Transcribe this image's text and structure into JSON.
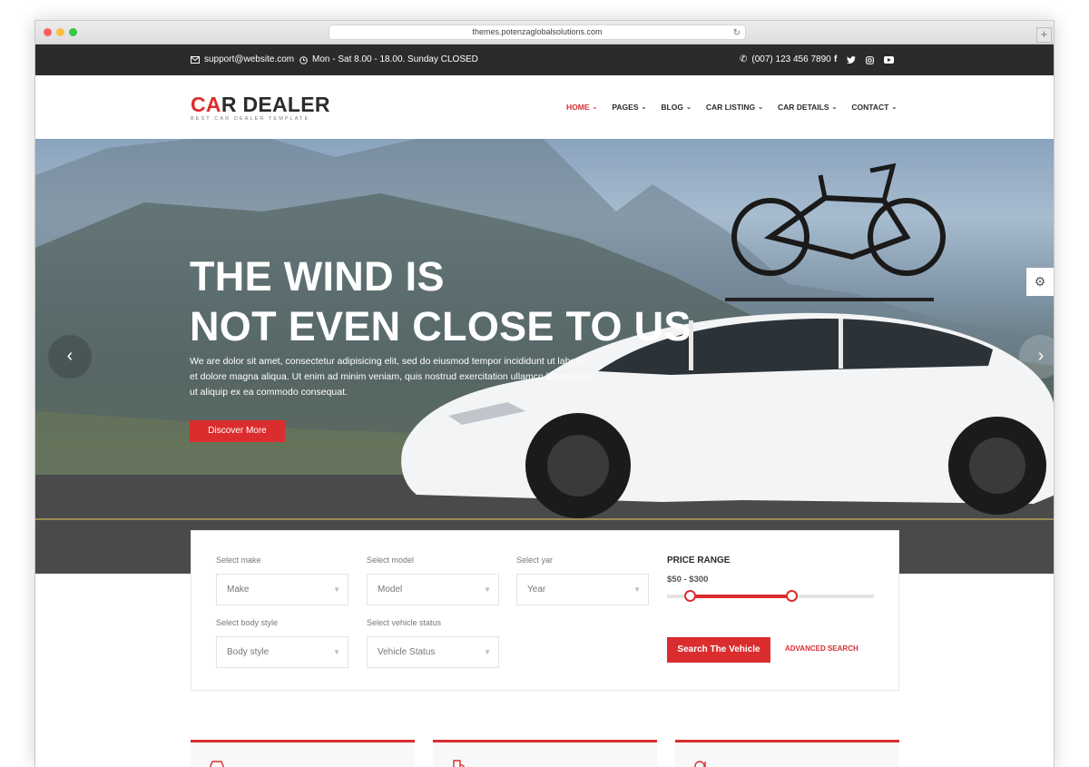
{
  "browser": {
    "url": "themes.potenzaglobalsolutions.com",
    "reload_icon": "↻",
    "newtab_icon": "+"
  },
  "topbar": {
    "email": "support@website.com",
    "hours": "Mon - Sat 8.00 - 18.00. Sunday CLOSED",
    "phone": "(007) 123 456 7890",
    "social_icons": [
      "facebook-icon",
      "twitter-icon",
      "instagram-icon",
      "youtube-icon"
    ]
  },
  "logo": {
    "prefix": "C",
    "red_part": "A",
    "rest": "R DEALER",
    "tagline": "BEST CAR DEALER TEMPLATE"
  },
  "nav": {
    "items": [
      {
        "label": "HOME",
        "active": true
      },
      {
        "label": "PAGES",
        "active": false
      },
      {
        "label": "BLOG",
        "active": false
      },
      {
        "label": "CAR LISTING",
        "active": false
      },
      {
        "label": "CAR DETAILS",
        "active": false
      },
      {
        "label": "CONTACT",
        "active": false
      }
    ]
  },
  "hero": {
    "title_line1": "THE WIND IS",
    "title_line2": "NOT EVEN CLOSE TO US",
    "text": "We are dolor sit amet, consectetur adipisicing elit, sed do eiusmod tempor incididunt ut labore et dolore magna aliqua. Ut enim ad minim veniam, quis nostrud exercitation ullamco laboris nisi ut aliquip ex ea commodo consequat.",
    "button": "Discover More"
  },
  "search": {
    "make": {
      "label": "Select make",
      "value": "Make"
    },
    "model": {
      "label": "Select model",
      "value": "Model"
    },
    "year": {
      "label": "Select yar",
      "value": "Year"
    },
    "body": {
      "label": "Select body style",
      "value": "Body style"
    },
    "status": {
      "label": "Select vehicle status",
      "value": "Vehicle Status"
    },
    "price_title": "PRICE RANGE",
    "price_value": "$50 - $300",
    "price_range": {
      "low_fraction": 0.11,
      "high_fraction": 0.6
    },
    "search_button": "Search The Vehicle",
    "advanced_link": "ADVANCED SEARCH"
  },
  "colors": {
    "accent": "#db2d2e",
    "dark": "#2b2b2b"
  }
}
